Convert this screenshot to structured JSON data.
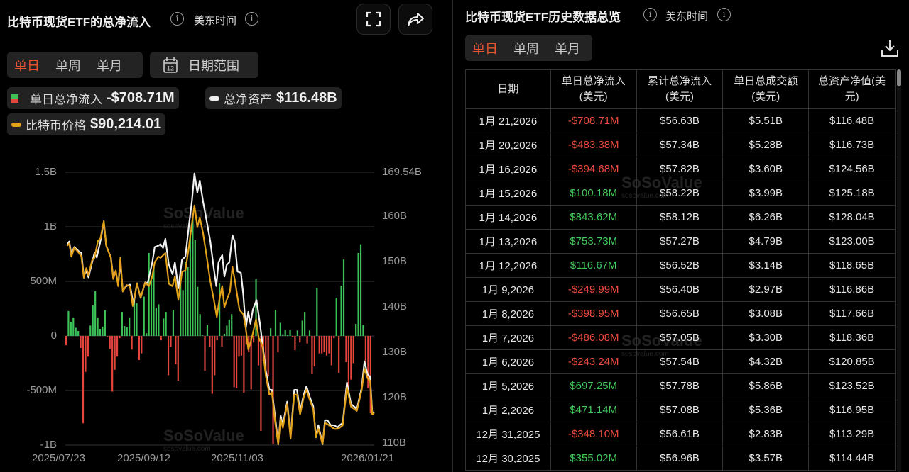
{
  "left": {
    "title": "比特币现货ETF的总净流入",
    "timezone": "美东时间",
    "tabs": [
      "单日",
      "单周",
      "单月"
    ],
    "date_range": "日期范围",
    "calendar_day": "12",
    "legend": [
      {
        "label": "单日总净流入",
        "value": "-$708.71M"
      },
      {
        "label": "总净资产",
        "value": "$116.48B"
      },
      {
        "label": "比特币价格",
        "value": "$90,214.01"
      }
    ]
  },
  "watermark": {
    "name": "SoSoValue",
    "url": "sosovalue.com"
  },
  "colors": {
    "green": "#3cc257",
    "red": "#e5443c",
    "asset_line": "#f2f2f2",
    "price_line": "#e3a11a",
    "accent": "#e9562f"
  },
  "chart_data": {
    "type": "bar+line",
    "left_axis": {
      "ticks": [
        "1.5B",
        "1B",
        "500M",
        "0",
        "-500M",
        "-1B"
      ],
      "range_millions": [
        -1000,
        1500
      ]
    },
    "right_axis": {
      "ticks": [
        "169.54B",
        "160B",
        "150B",
        "140B",
        "130B",
        "120B",
        "110B"
      ],
      "range_billions": [
        110,
        169.54
      ]
    },
    "x_ticks": [
      "2025/07/23",
      "2025/09/12",
      "2025/11/03",
      "2026/01/21"
    ],
    "series": [
      {
        "name": "单日总净流入",
        "unit": "M USD",
        "values": [
          -85,
          228,
          130,
          170,
          75,
          45,
          -110,
          -800,
          -330,
          -190,
          95,
          280,
          410,
          170,
          65,
          85,
          235,
          -5,
          -120,
          -510,
          -310,
          -190,
          -20,
          220,
          90,
          80,
          170,
          -125,
          330,
          300,
          -220,
          -160,
          360,
          25,
          760,
          550,
          650,
          260,
          290,
          -40,
          160,
          220,
          -360,
          -100,
          240,
          -260,
          -410,
          500,
          420,
          680,
          630,
          970,
          1120,
          880,
          450,
          200,
          5,
          -320,
          100,
          -100,
          -530,
          -360,
          -40,
          480,
          -100,
          20,
          95,
          150,
          200,
          -470,
          -480,
          -190,
          -180,
          -520,
          -80,
          -150,
          -490,
          -60,
          520,
          -270,
          -870,
          -230,
          -310,
          -370,
          70,
          -990,
          240,
          -150,
          120,
          15,
          55,
          10,
          55,
          -10,
          -130,
          50,
          -60,
          140,
          220,
          -70,
          50,
          -350,
          -280,
          440,
          -160,
          -160,
          -150,
          -180,
          -160,
          -270,
          -20,
          350,
          -340,
          460,
          700,
          -240,
          -490,
          -400,
          -250,
          110,
          760,
          840,
          100,
          -250,
          -480,
          -708.71
        ]
      },
      {
        "name": "总净资产",
        "unit": "B USD",
        "points": [
          [
            0.5,
            153.8
          ],
          [
            1.3,
            154.4
          ],
          [
            2.2,
            151.7
          ],
          [
            3.4,
            153.2
          ],
          [
            5.3,
            152.2
          ],
          [
            6.3,
            151.9
          ],
          [
            7.3,
            146.7
          ],
          [
            8.3,
            148.0
          ],
          [
            9.2,
            146.5
          ],
          [
            10.7,
            149.8
          ],
          [
            11.7,
            151.9
          ],
          [
            12.6,
            150.9
          ],
          [
            14.1,
            154.5
          ],
          [
            15.5,
            158.7
          ],
          [
            16.5,
            153.5
          ],
          [
            18.4,
            150.9
          ],
          [
            19.4,
            146.5
          ],
          [
            20.4,
            147.8
          ],
          [
            21.4,
            144.9
          ],
          [
            22.3,
            149.8
          ],
          [
            23.3,
            143.6
          ],
          [
            24.8,
            144.6
          ],
          [
            26.2,
            144.9
          ],
          [
            27.7,
            140.5
          ],
          [
            29.1,
            145.2
          ],
          [
            30.6,
            142.0
          ],
          [
            32.5,
            145.4
          ],
          [
            33.5,
            145.2
          ],
          [
            35.4,
            149.8
          ],
          [
            36.4,
            153.2
          ],
          [
            37.9,
            153.5
          ],
          [
            38.8,
            153.8
          ],
          [
            39.8,
            153.0
          ],
          [
            40.8,
            155.0
          ],
          [
            42.2,
            149.3
          ],
          [
            43.7,
            147.2
          ],
          [
            44.7,
            149.8
          ],
          [
            46.1,
            144.1
          ],
          [
            47.6,
            150.4
          ],
          [
            49,
            151.1
          ],
          [
            50.5,
            158.2
          ],
          [
            51.7,
            163.4
          ],
          [
            52.7,
            169.4
          ],
          [
            53.9,
            165.2
          ],
          [
            54.9,
            167.8
          ],
          [
            56.3,
            163.1
          ],
          [
            57.8,
            158.7
          ],
          [
            59.2,
            154.5
          ],
          [
            60.7,
            148.3
          ],
          [
            61.7,
            144.6
          ],
          [
            62.6,
            149.8
          ],
          [
            64.1,
            151.4
          ],
          [
            65,
            146.7
          ],
          [
            66,
            149.3
          ],
          [
            67,
            149.8
          ],
          [
            68.3,
            155.8
          ],
          [
            69.2,
            154.5
          ],
          [
            70.4,
            147.8
          ],
          [
            71.8,
            147.5
          ],
          [
            72.8,
            142.5
          ],
          [
            73.8,
            135.3
          ],
          [
            74.8,
            138.9
          ],
          [
            75.7,
            136.3
          ],
          [
            76.7,
            139.4
          ],
          [
            78.2,
            141.5
          ],
          [
            79.6,
            136.3
          ],
          [
            80.6,
            132.1
          ],
          [
            82,
            125.9
          ],
          [
            83.5,
            121.7
          ],
          [
            84.5,
            121.7
          ],
          [
            85.9,
            115.5
          ],
          [
            87.1,
            109.7
          ],
          [
            88.1,
            116.0
          ],
          [
            89,
            113.9
          ],
          [
            90.8,
            119.1
          ],
          [
            92.2,
            111.3
          ],
          [
            93.7,
            121.7
          ],
          [
            94.8,
            121.7
          ],
          [
            96.1,
            117.0
          ],
          [
            97.6,
            120.7
          ],
          [
            98.7,
            122.5
          ],
          [
            100,
            120.2
          ],
          [
            101.5,
            118.1
          ],
          [
            102.6,
            111.3
          ],
          [
            103.6,
            113.9
          ],
          [
            105.3,
            109.7
          ],
          [
            106.3,
            115.0
          ],
          [
            107.3,
            115.0
          ],
          [
            108.7,
            113.9
          ],
          [
            110.2,
            113.9
          ],
          [
            111.4,
            113.4
          ],
          [
            112.3,
            113.9
          ],
          [
            113.6,
            114.4
          ],
          [
            115.3,
            123.3
          ],
          [
            117,
            118.6
          ],
          [
            119.4,
            117.5
          ],
          [
            121.4,
            122.2
          ],
          [
            122.5,
            128.0
          ],
          [
            123.8,
            125.1
          ],
          [
            124.8,
            124.6
          ],
          [
            125.7,
            116.8
          ],
          [
            126.5,
            116.48
          ]
        ]
      },
      {
        "name": "比特币价格",
        "unit": "K USD",
        "points": [
          [
            0.5,
            118.0
          ],
          [
            1.3,
            118.4
          ],
          [
            2.2,
            116.2
          ],
          [
            3.4,
            117.7
          ],
          [
            5.3,
            116.8
          ],
          [
            6.3,
            116.2
          ],
          [
            7.3,
            112.7
          ],
          [
            8.3,
            114.3
          ],
          [
            9.2,
            113.1
          ],
          [
            10.7,
            115.6
          ],
          [
            11.7,
            116.0
          ],
          [
            13.1,
            118.8
          ],
          [
            14.1,
            119.2
          ],
          [
            15.5,
            122.1
          ],
          [
            16.5,
            118.0
          ],
          [
            18.4,
            116.0
          ],
          [
            19.4,
            112.5
          ],
          [
            20.4,
            113.9
          ],
          [
            21.4,
            111.3
          ],
          [
            22.3,
            116.0
          ],
          [
            23.3,
            110.4
          ],
          [
            24.8,
            111.5
          ],
          [
            26.2,
            111.3
          ],
          [
            27.4,
            108.0
          ],
          [
            29.1,
            111.7
          ],
          [
            30.6,
            109.4
          ],
          [
            32.5,
            111.9
          ],
          [
            34,
            111.3
          ],
          [
            35.4,
            112.9
          ],
          [
            36.4,
            115.3
          ],
          [
            37.9,
            116.2
          ],
          [
            38.8,
            116.0
          ],
          [
            40.8,
            116.8
          ],
          [
            42.2,
            111.7
          ],
          [
            43.7,
            111.3
          ],
          [
            44.7,
            112.9
          ],
          [
            46.1,
            109.0
          ],
          [
            47.6,
            113.7
          ],
          [
            49,
            113.9
          ],
          [
            50.5,
            118.0
          ],
          [
            51.7,
            121.7
          ],
          [
            52.7,
            124.7
          ],
          [
            53.9,
            121.1
          ],
          [
            54.9,
            122.7
          ],
          [
            56.3,
            120.0
          ],
          [
            57.8,
            116.0
          ],
          [
            59.2,
            112.1
          ],
          [
            60.7,
            109.0
          ],
          [
            61.9,
            106.2
          ],
          [
            63.1,
            109.4
          ],
          [
            64.1,
            111.3
          ],
          [
            65,
            107.8
          ],
          [
            66.3,
            109.4
          ],
          [
            67.3,
            110.4
          ],
          [
            68.3,
            114.5
          ],
          [
            69.4,
            112.1
          ],
          [
            70.4,
            109.4
          ],
          [
            71.2,
            107.4
          ],
          [
            72.8,
            106.6
          ],
          [
            73.8,
            104.3
          ],
          [
            74.8,
            100.8
          ],
          [
            75.7,
            101.9
          ],
          [
            76.7,
            103.5
          ],
          [
            78,
            105.8
          ],
          [
            79.1,
            102.7
          ],
          [
            80.6,
            101.5
          ],
          [
            82,
            96.4
          ],
          [
            83.5,
            93.3
          ],
          [
            84.5,
            93.7
          ],
          [
            85.9,
            88.6
          ],
          [
            87.1,
            85.1
          ],
          [
            88.1,
            89.2
          ],
          [
            89,
            87.8
          ],
          [
            90.8,
            91.7
          ],
          [
            92.2,
            86.0
          ],
          [
            93.7,
            93.3
          ],
          [
            94.8,
            93.3
          ],
          [
            96.1,
            90.0
          ],
          [
            97.6,
            92.9
          ],
          [
            98.7,
            94.1
          ],
          [
            100,
            92.5
          ],
          [
            101.5,
            90.9
          ],
          [
            102.6,
            86.2
          ],
          [
            103.6,
            87.6
          ],
          [
            105.3,
            85.1
          ],
          [
            106.3,
            88.6
          ],
          [
            107.3,
            88.4
          ],
          [
            108.7,
            88.0
          ],
          [
            110.2,
            87.6
          ],
          [
            111.4,
            87.6
          ],
          [
            112.3,
            87.8
          ],
          [
            113.6,
            88.2
          ],
          [
            115.3,
            94.5
          ],
          [
            117,
            91.3
          ],
          [
            119.4,
            90.6
          ],
          [
            121.4,
            94.1
          ],
          [
            122.5,
            97.6
          ],
          [
            123.8,
            96.0
          ],
          [
            124.8,
            95.6
          ],
          [
            125.7,
            90.0
          ],
          [
            126.5,
            90.214
          ]
        ]
      }
    ]
  },
  "right": {
    "title": "比特币现货ETF历史数据总览",
    "timezone": "美东时间",
    "tabs": [
      "单日",
      "单周",
      "单月"
    ],
    "columns": [
      "日期",
      "单日总净流入\n(美元)",
      "累计总净流入\n(美元)",
      "单日总成交额\n(美元)",
      "总资产净值(美\n元)"
    ],
    "rows": [
      [
        "1月 21,2026",
        "-$708.71M",
        "$56.63B",
        "$5.51B",
        "$116.48B"
      ],
      [
        "1月 20,2026",
        "-$483.38M",
        "$57.34B",
        "$5.28B",
        "$116.73B"
      ],
      [
        "1月 16,2026",
        "-$394.68M",
        "$57.82B",
        "$3.60B",
        "$124.56B"
      ],
      [
        "1月 15,2026",
        "$100.18M",
        "$58.22B",
        "$3.99B",
        "$125.18B"
      ],
      [
        "1月 14,2026",
        "$843.62M",
        "$58.12B",
        "$6.26B",
        "$128.04B"
      ],
      [
        "1月 13,2026",
        "$753.73M",
        "$57.27B",
        "$4.79B",
        "$123.00B"
      ],
      [
        "1月 12,2026",
        "$116.67M",
        "$56.52B",
        "$3.14B",
        "$118.65B"
      ],
      [
        "1月 9,2026",
        "-$249.99M",
        "$56.40B",
        "$2.97B",
        "$116.86B"
      ],
      [
        "1月 8,2026",
        "-$398.95M",
        "$56.65B",
        "$3.08B",
        "$117.66B"
      ],
      [
        "1月 7,2026",
        "-$486.08M",
        "$57.05B",
        "$3.30B",
        "$118.36B"
      ],
      [
        "1月 6,2026",
        "-$243.24M",
        "$57.54B",
        "$4.32B",
        "$120.85B"
      ],
      [
        "1月 5,2026",
        "$697.25M",
        "$57.78B",
        "$5.86B",
        "$123.52B"
      ],
      [
        "1月 2,2026",
        "$471.14M",
        "$57.08B",
        "$5.36B",
        "$116.95B"
      ],
      [
        "12月 31,2025",
        "-$348.10M",
        "$56.61B",
        "$2.83B",
        "$113.29B"
      ],
      [
        "12月 30,2025",
        "$355.02M",
        "$56.96B",
        "$3.57B",
        "$114.44B"
      ]
    ]
  }
}
